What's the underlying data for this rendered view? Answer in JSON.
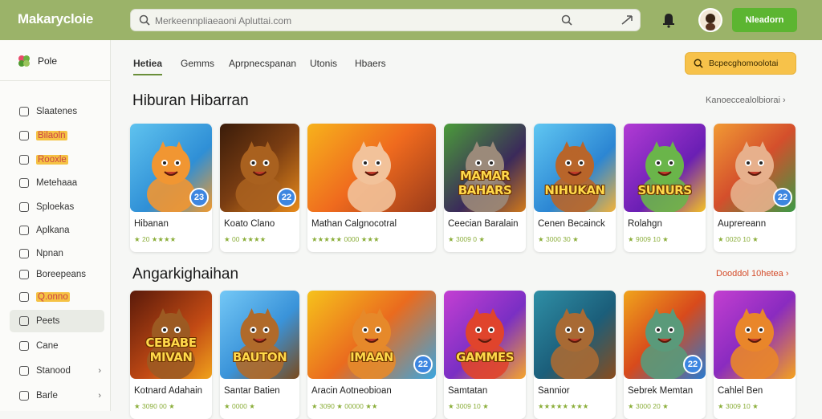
{
  "app": {
    "logo": "Makarycloie",
    "cta_label": "Nleadorn"
  },
  "search": {
    "placeholder": "Merkeennpliaeaoni Apluttai.com"
  },
  "sidebar": {
    "top": "Pole",
    "items": [
      {
        "label": "Slaatenes"
      },
      {
        "label": "Bilaoln",
        "highlight": true
      },
      {
        "label": "Rooxle",
        "highlight": true
      },
      {
        "label": "Metehaaa"
      },
      {
        "label": "Sploekas"
      },
      {
        "label": "Aplkana"
      },
      {
        "label": "Npnan"
      },
      {
        "label": "Boreepeans"
      },
      {
        "label": "Q.onno",
        "highlight": true
      },
      {
        "label": "Peets",
        "active": true
      },
      {
        "label": "Cane"
      },
      {
        "label": "Stanood",
        "chevron": "›"
      },
      {
        "label": "Barle",
        "chevron": "›"
      }
    ]
  },
  "tabs": [
    "Hetiea",
    "Gemms",
    "Aprpnecspanan",
    "Utonis",
    "Hbaers"
  ],
  "promo": {
    "label": "Bcpecghomoolotai"
  },
  "section1": {
    "title": "Hiburan Hibarran",
    "link": "Kanoeccealolbiorai ›",
    "cards": [
      {
        "name": "Hibanan",
        "rating": "★ 20 ★★★★",
        "badge": "23"
      },
      {
        "name": "Koato Clano",
        "rating": "★ 00 ★★★★",
        "badge": "22"
      },
      {
        "name": "Mathan Calgnocotral",
        "rating": "★★★★★ 0000 ★★★",
        "badge": ""
      },
      {
        "name": "Ceecian Baralain",
        "rating": "★ 3009 0 ★",
        "badge": ""
      },
      {
        "name": "Cenen Becainck",
        "rating": "★ 3000 30 ★",
        "badge": ""
      },
      {
        "name": "Rolahgn",
        "rating": "★ 9009 10 ★",
        "badge": ""
      },
      {
        "name": "Auprereann",
        "rating": "★ 0020 10 ★",
        "badge": "22"
      }
    ],
    "captions": [
      "",
      "",
      "",
      "MAMAR BAHARS",
      "NIHUKAN",
      "SUNURS",
      ""
    ]
  },
  "section2": {
    "title": "Angarkighaihan",
    "link": "Dooddol 10hetea ›",
    "cards": [
      {
        "name": "Kotnard Adahain",
        "rating": "★ 3090 00 ★",
        "badge": ""
      },
      {
        "name": "Santar Batien",
        "rating": "★ 0000 ★",
        "badge": ""
      },
      {
        "name": "Aracin Aotneobioan",
        "rating": "★ 3090 ★ 00000 ★★",
        "badge": "22"
      },
      {
        "name": "Samtatan",
        "rating": "★ 3009 10 ★",
        "badge": ""
      },
      {
        "name": "Sannior",
        "rating": "★★★★★ ★★★",
        "badge": ""
      },
      {
        "name": "Sebrek Memtan",
        "rating": "★ 3000 20 ★",
        "badge": "22"
      },
      {
        "name": "Cahlel Ben",
        "rating": "★ 3009 10 ★",
        "badge": ""
      }
    ],
    "captions": [
      "CEBABE MIVAN",
      "BAUTON",
      "IMAAN",
      "GAMMES",
      "",
      "",
      ""
    ]
  }
}
